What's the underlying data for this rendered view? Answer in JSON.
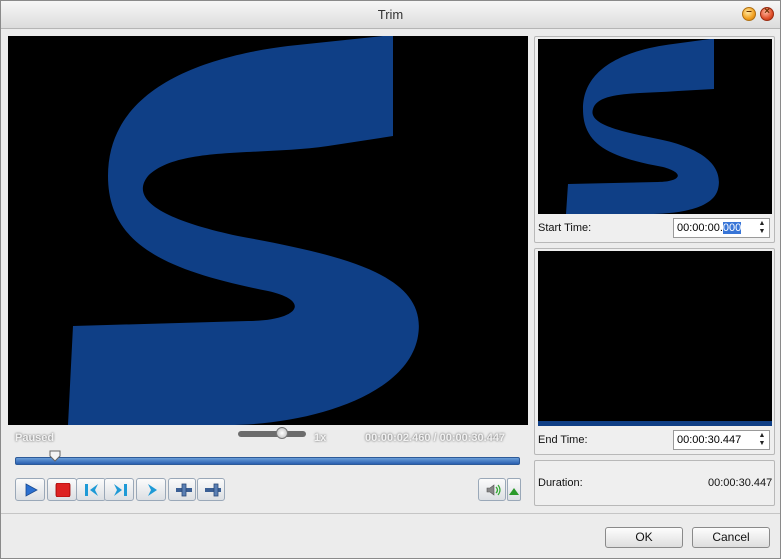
{
  "window": {
    "title": "Trim"
  },
  "player": {
    "status": "Paused",
    "speed": "1x",
    "speed_level": 0.65,
    "timecode": "00:00:02.460 / 00:00:30.447",
    "seek_position": 0.08
  },
  "start": {
    "label": "Start Time:",
    "value_prefix": "00:00:00.",
    "value_selected": "000"
  },
  "end": {
    "label": "End Time:",
    "value": "00:00:30.447"
  },
  "duration": {
    "label": "Duration:",
    "value": "00:00:30.447"
  },
  "buttons": {
    "ok": "OK",
    "cancel": "Cancel"
  },
  "colors": {
    "logo_blue": "#0f3f86",
    "seek_blue": "#2a5fb0"
  },
  "icons": [
    "play-icon",
    "stop-icon",
    "previous-frame-icon",
    "next-frame-icon",
    "forward-icon",
    "set-start-marker-icon",
    "set-end-marker-icon",
    "volume-icon"
  ]
}
